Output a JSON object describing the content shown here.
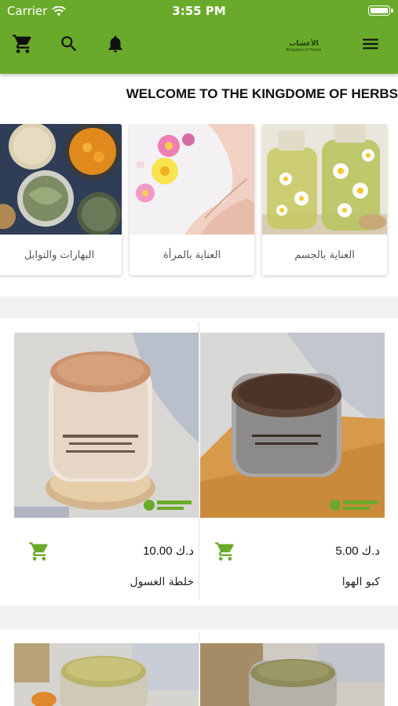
{
  "status_bar": {
    "carrier": "Carrier",
    "time": "3:55 PM"
  },
  "toolbar": {
    "icons": [
      "cart-icon",
      "search-icon",
      "bell-icon",
      "menu-icon"
    ],
    "logo_ar": "الأعشاب",
    "logo_en": "Kingdom of Herbs",
    "accent_color": "#6aaa2a"
  },
  "welcome_text": "WELCOME TO THE KINGDOME OF HERBS",
  "categories": [
    {
      "label": "البهارات والتوابل"
    },
    {
      "label": "العناية بالمرأة"
    },
    {
      "label": "العناية بالجسم"
    }
  ],
  "products": [
    {
      "name": "خلطة الغسول",
      "price": "10.00 د.ك"
    },
    {
      "name": "كبو الهوا",
      "price": "5.00 د.ك"
    },
    {
      "name": "",
      "price": ""
    },
    {
      "name": "",
      "price": ""
    }
  ]
}
